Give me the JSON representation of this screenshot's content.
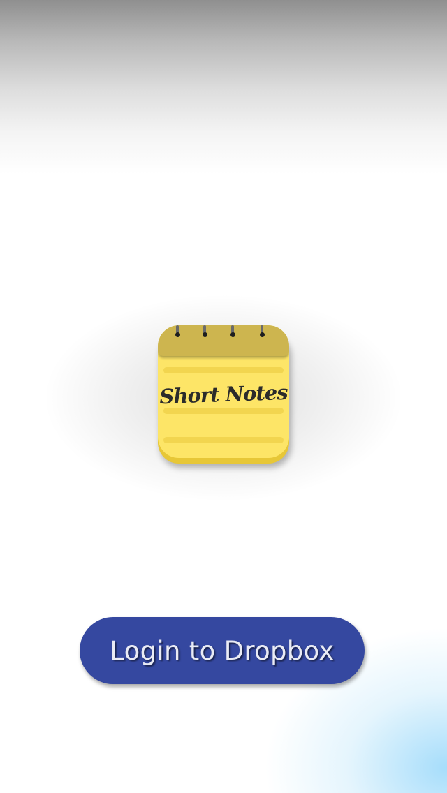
{
  "app_icon": {
    "icon_name": "notepad-icon",
    "title": "Short Notes",
    "page_color": "#fde567",
    "header_color": "#cdb54f"
  },
  "login": {
    "label": "Login to Dropbox",
    "color": "#3548a0"
  }
}
